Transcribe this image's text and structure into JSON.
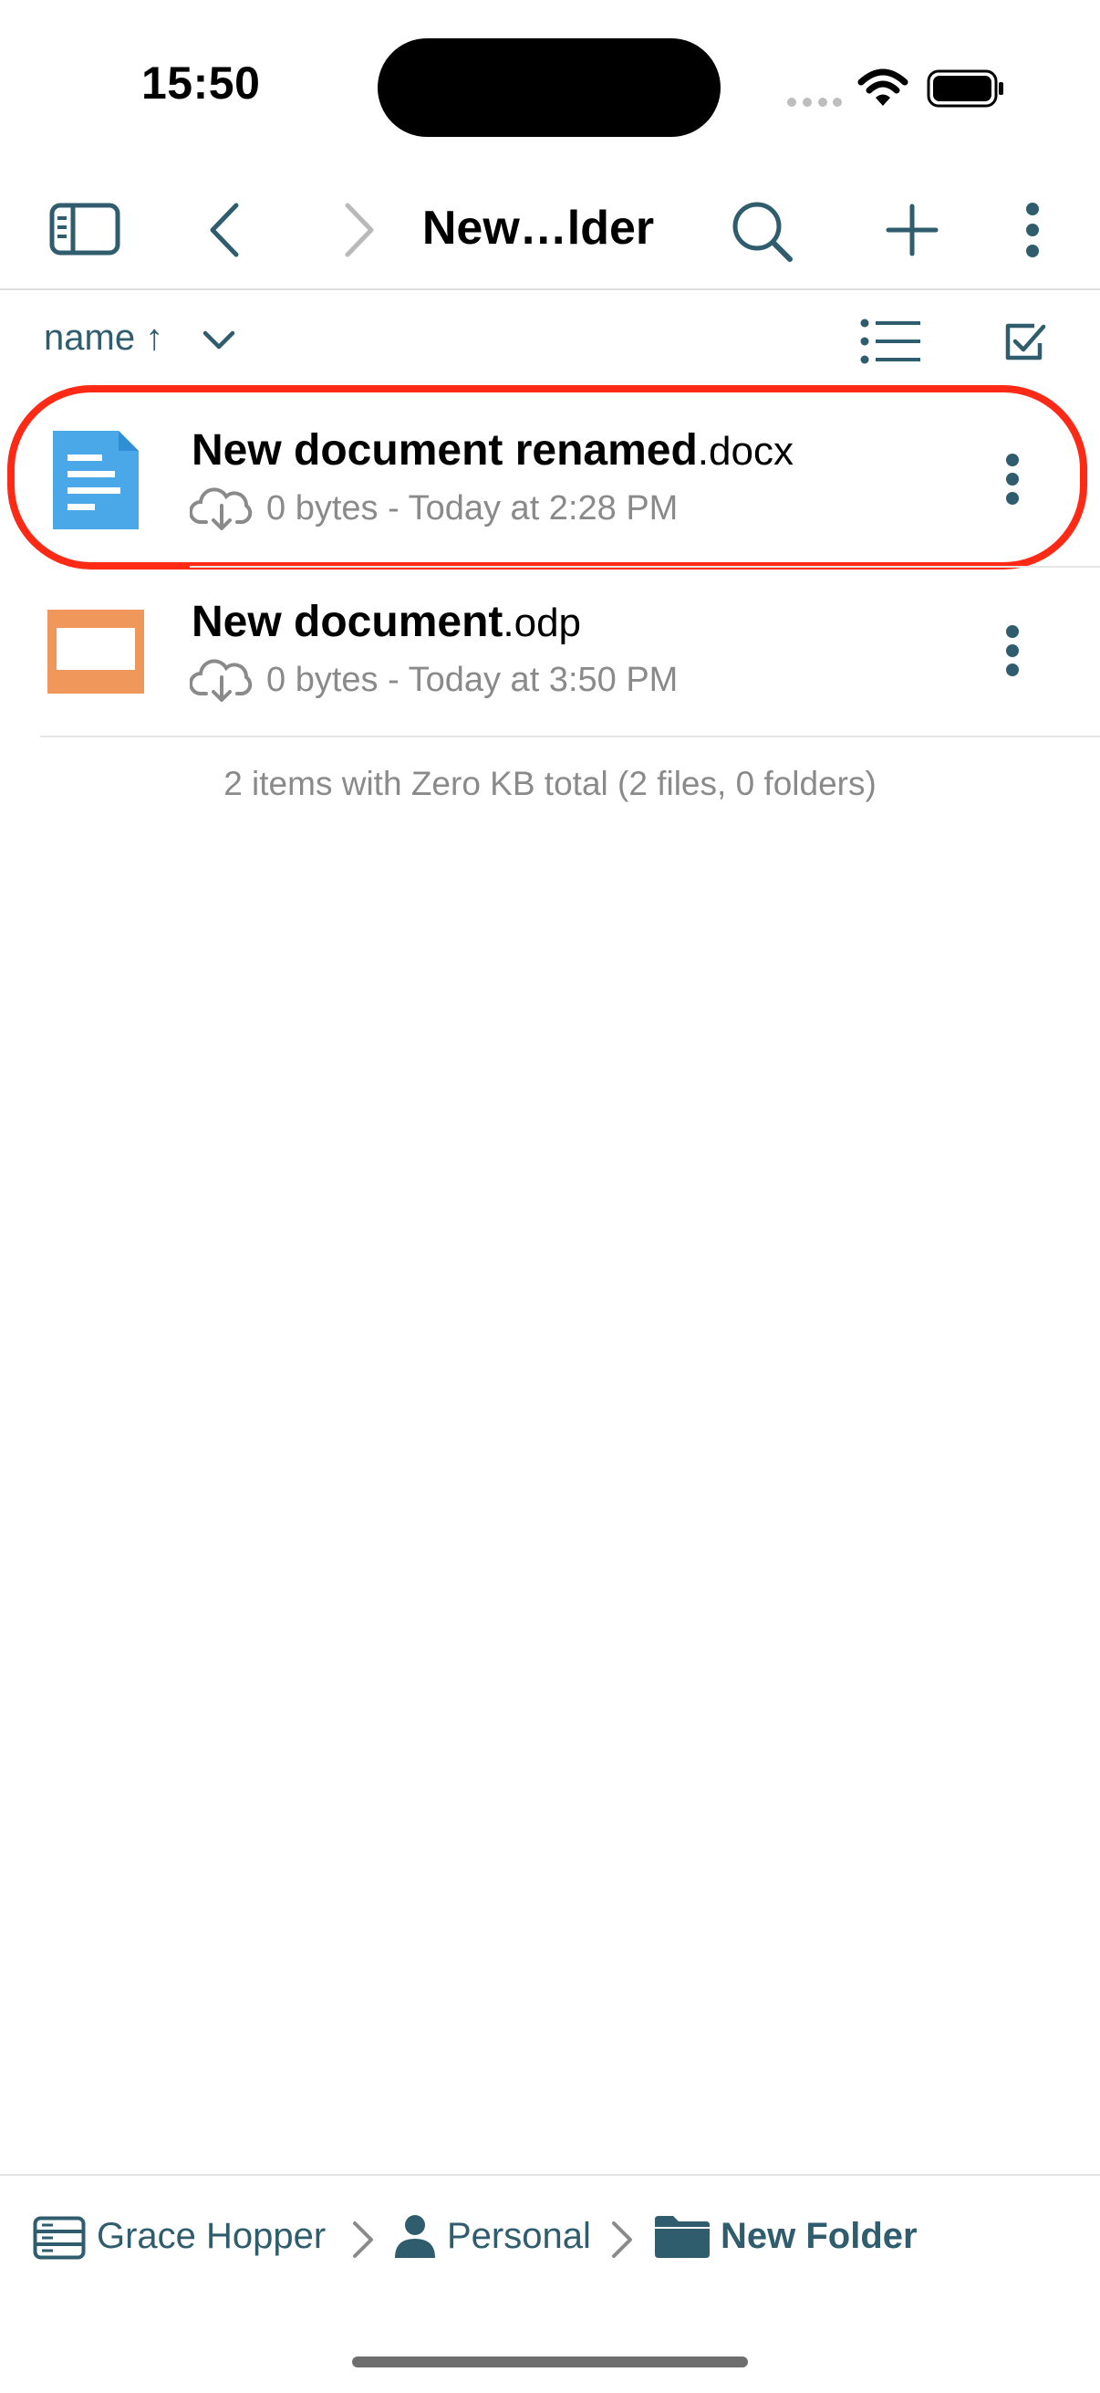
{
  "status_bar": {
    "time": "15:50"
  },
  "toolbar": {
    "title": "New…lder",
    "icons": [
      "sidebar-icon",
      "back-icon",
      "forward-icon",
      "search-icon",
      "plus-icon",
      "more-icon"
    ]
  },
  "sort": {
    "label": "name ↑",
    "view_icons": [
      "list-view-icon",
      "select-checkbox-icon"
    ]
  },
  "files": [
    {
      "name": "New document renamed",
      "ext": ".docx",
      "meta": "0 bytes - Today at 2:28 PM",
      "type_icon": "docx-file-icon",
      "color": "#4aa8e8",
      "highlighted": true
    },
    {
      "name": "New document",
      "ext": ".odp",
      "meta": "0 bytes - Today at 3:50 PM",
      "type_icon": "odp-file-icon",
      "color": "#f0985c",
      "highlighted": false
    }
  ],
  "summary": "2 items with Zero KB total (2 files, 0 folders)",
  "breadcrumb": [
    {
      "label": "Grace Hopper",
      "icon": "server-icon"
    },
    {
      "label": "Personal",
      "icon": "person-icon"
    },
    {
      "label": "New Folder",
      "icon": "folder-icon"
    }
  ],
  "colors": {
    "accent": "#2f5d6e",
    "highlight_ring": "#ff2a16"
  }
}
